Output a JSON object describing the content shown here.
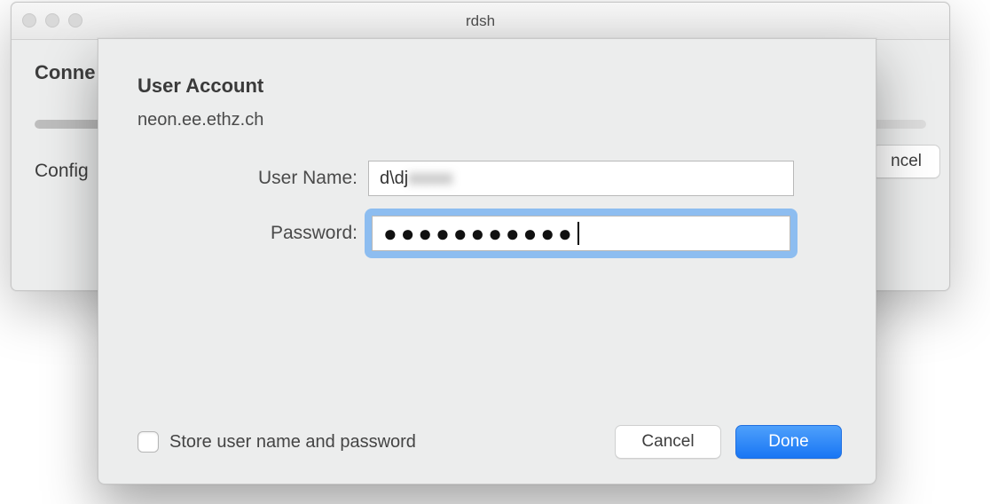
{
  "window": {
    "title": "rdsh",
    "heading_prefix": "Conne",
    "config_prefix": "Config",
    "cancel_suffix": "ncel"
  },
  "sheet": {
    "title": "User Account",
    "host": "neon.ee.ethz.ch",
    "username_label": "User Name:",
    "username_value_visible": "d\\dj",
    "username_value_blurred": "xxxxx",
    "password_label": "Password:",
    "password_masked": "●●●●●●●●●●●",
    "store_label": "Store user name and password",
    "cancel": "Cancel",
    "done": "Done"
  }
}
